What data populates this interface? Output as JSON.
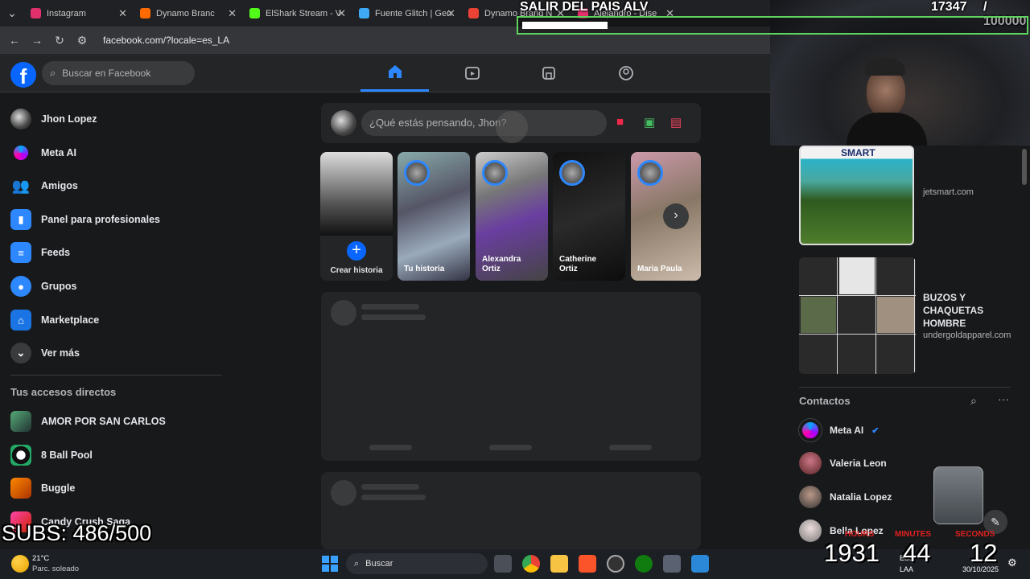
{
  "browser": {
    "tabs": [
      {
        "label": "Instagram",
        "color": "#e1306c"
      },
      {
        "label": "Dynamo Branc",
        "color": "#ff6a00"
      },
      {
        "label": "ElShark Stream - V",
        "color": "#53fc18"
      },
      {
        "label": "Fuente Glitch | Gen",
        "color": "#3fa9f5"
      },
      {
        "label": "Dynamo Brand N",
        "color": "#ea4335"
      },
      {
        "label": "Alejandro - Dise",
        "color": "#e1306c"
      },
      {
        "label": "Dynamo Bran",
        "color": "#ff6a00"
      }
    ],
    "url": "facebook.com/?locale=es_LA"
  },
  "header": {
    "search_placeholder": "Buscar en Facebook"
  },
  "left_nav": {
    "items": [
      {
        "label": "Jhon Lopez",
        "icon": "profile-avatar"
      },
      {
        "label": "Meta AI",
        "icon": "meta-ai-icon"
      },
      {
        "label": "Amigos",
        "icon": "friends-icon"
      },
      {
        "label": "Panel para profesionales",
        "icon": "dashboard-icon"
      },
      {
        "label": "Feeds",
        "icon": "feeds-icon"
      },
      {
        "label": "Grupos",
        "icon": "groups-icon"
      },
      {
        "label": "Marketplace",
        "icon": "marketplace-icon"
      },
      {
        "label": "Ver más",
        "icon": "chevron-down-icon"
      }
    ],
    "shortcuts_title": "Tus accesos directos",
    "shortcuts": [
      {
        "label": "AMOR POR SAN CARLOS"
      },
      {
        "label": "8 Ball Pool"
      },
      {
        "label": "Buggle"
      },
      {
        "label": "Candy Crush Saga"
      }
    ]
  },
  "composer": {
    "placeholder": "¿Qué estás pensando, Jhon?"
  },
  "stories": [
    {
      "label": "Crear historia"
    },
    {
      "label": "Tu historia"
    },
    {
      "label": "Alexandra Ortiz"
    },
    {
      "label": "Catherine Ortiz"
    },
    {
      "label": "Maria Paula"
    }
  ],
  "ads": [
    {
      "brand": "SMART",
      "domain": "jetsmart.com"
    },
    {
      "title": "BUZOS Y CHAQUETAS HOMBRE",
      "domain": "undergoldapparel.com"
    }
  ],
  "contacts": {
    "title": "Contactos",
    "items": [
      {
        "name": "Meta AI"
      },
      {
        "name": "Valeria Leon"
      },
      {
        "name": "Natalia Lopez"
      },
      {
        "name": "Bella Lopez"
      }
    ]
  },
  "overlay": {
    "goal_title": "SALIR DEL PAIS ALV",
    "goal_count": "17347",
    "goal_total": "/ 100000",
    "goal_progress": 0.17,
    "subs": "SUBS: 486/500",
    "timer": {
      "hours_label": "HOURS",
      "minutes_label": "MINUTES",
      "seconds_label": "SECONDS",
      "hours": "1931",
      "minutes": "44",
      "seconds": "12"
    }
  },
  "taskbar": {
    "weather_temp": "21°C",
    "weather_desc": "Parc. soleado",
    "search_label": "Buscar",
    "lang": "ESP",
    "region": "LAA",
    "date": "30/10/2025"
  }
}
